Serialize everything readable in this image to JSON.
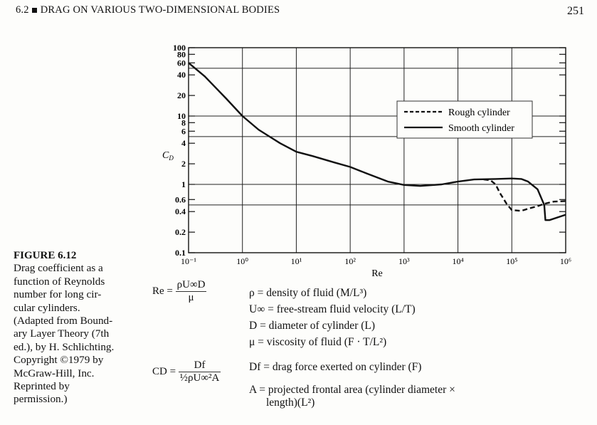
{
  "header": {
    "section": "6.2",
    "title": "DRAG ON VARIOUS TWO-DIMENSIONAL BODIES",
    "page_number": "251"
  },
  "caption": {
    "figure_label": "FIGURE 6.12",
    "lines": [
      "Drag coefficient as a",
      "function of Reynolds",
      "number for long cir-",
      "cular cylinders.",
      "(Adapted from Bound-",
      "ary Layer Theory (7th",
      "ed.), by H. Schlichting.",
      "Copyright ©1979 by",
      "McGraw-Hill, Inc.",
      "Reprinted by",
      "permission.)"
    ]
  },
  "equations": {
    "re_lhs": "Re =",
    "re_num": "ρU∞D",
    "re_den": "μ",
    "cd_lhs": "CD =",
    "cd_num": "Df",
    "cd_den": "½ρU∞²A"
  },
  "definitions": [
    "ρ = density of fluid (M/L³)",
    "U∞ = free-stream fluid velocity (L/T)",
    "D = diameter of cylinder (L)",
    "μ = viscosity of fluid (F · T/L²)",
    "Df = drag force exerted on cylinder (F)",
    "A = projected frontal area (cylinder diameter ×",
    "length)(L²)"
  ],
  "chart_data": {
    "type": "line",
    "title": "",
    "xlabel": "Re",
    "ylabel": "CD",
    "xscale": "log",
    "yscale": "log",
    "xlim": [
      0.1,
      1000000
    ],
    "ylim": [
      0.1,
      100
    ],
    "grid": true,
    "x_ticks": [
      "10⁻¹",
      "10⁰",
      "10¹",
      "10²",
      "10³",
      "10⁴",
      "10⁵",
      "10⁶"
    ],
    "x_tick_values": [
      0.1,
      1,
      10,
      100,
      1000,
      10000,
      100000,
      1000000
    ],
    "y_ticks": [
      "100",
      "80",
      "60",
      "40",
      "20",
      "10",
      "8",
      "6",
      "4",
      "2",
      "1",
      "0.6",
      "0.4",
      "0.2",
      "0.1"
    ],
    "y_tick_values": [
      100,
      80,
      60,
      40,
      20,
      10,
      8,
      6,
      4,
      2,
      1,
      0.6,
      0.4,
      0.2,
      0.1
    ],
    "y_gridlines": [
      50,
      10,
      5,
      1,
      0.5
    ],
    "legend_position": "top-right",
    "series": [
      {
        "name": "Smooth cylinder",
        "style": "solid",
        "x": [
          0.1,
          0.2,
          0.5,
          1,
          2,
          5,
          10,
          20,
          50,
          100,
          200,
          500,
          1000,
          2000,
          5000,
          10000,
          20000,
          50000,
          100000,
          150000,
          200000,
          300000,
          400000,
          420000,
          500000,
          1000000
        ],
        "y": [
          60,
          38,
          18,
          10,
          6.3,
          4,
          3,
          2.6,
          2.1,
          1.8,
          1.45,
          1.1,
          0.98,
          0.95,
          1.0,
          1.1,
          1.18,
          1.2,
          1.22,
          1.2,
          1.1,
          0.85,
          0.5,
          0.3,
          0.3,
          0.36
        ]
      },
      {
        "name": "Rough cylinder",
        "style": "dashed",
        "x": [
          30000,
          40000,
          50000,
          60000,
          80000,
          100000,
          150000,
          200000,
          300000,
          400000,
          600000,
          1000000
        ],
        "y": [
          1.18,
          1.15,
          1.0,
          0.75,
          0.52,
          0.42,
          0.41,
          0.44,
          0.48,
          0.52,
          0.56,
          0.57
        ]
      }
    ]
  }
}
